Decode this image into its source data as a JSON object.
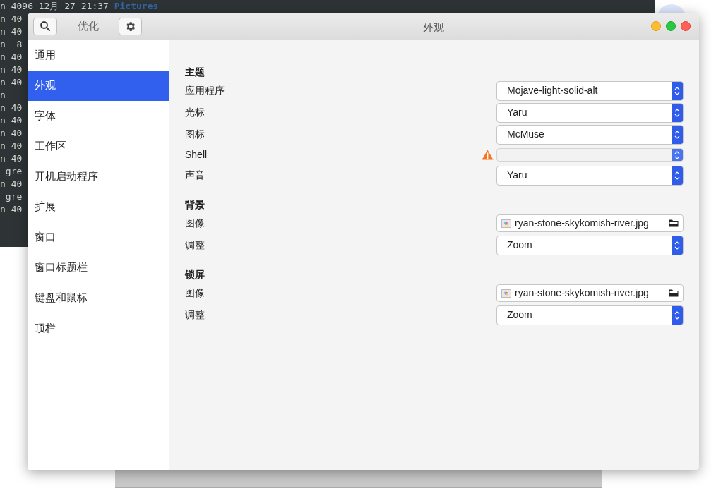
{
  "terminal": {
    "lines": [
      {
        "text": "n 4096 12月 27 21:37 ",
        "name": "Pictures"
      },
      {
        "text": "n 40"
      },
      {
        "text": "n 40"
      },
      {
        "text": "n  8"
      },
      {
        "text": "n 40"
      },
      {
        "text": "n 40"
      },
      {
        "text": "n 40"
      },
      {
        "text": "n"
      },
      {
        "text": "n 40"
      },
      {
        "text": "n 40"
      },
      {
        "text": "n 40"
      },
      {
        "text": "n 40"
      },
      {
        "text": "n 40"
      },
      {
        "text": " gre"
      },
      {
        "text": "n 40"
      },
      {
        "text": " gre"
      },
      {
        "text": "n 40"
      }
    ]
  },
  "window": {
    "app_title": "优化",
    "title": "外观"
  },
  "sidebar": {
    "items": [
      {
        "label": "通用",
        "selected": false
      },
      {
        "label": "外观",
        "selected": true
      },
      {
        "label": "字体",
        "selected": false
      },
      {
        "label": "工作区",
        "selected": false
      },
      {
        "label": "开机启动程序",
        "selected": false
      },
      {
        "label": "扩展",
        "selected": false
      },
      {
        "label": "窗口",
        "selected": false
      },
      {
        "label": "窗口标题栏",
        "selected": false
      },
      {
        "label": "键盘和鼠标",
        "selected": false
      },
      {
        "label": "顶栏",
        "selected": false
      }
    ]
  },
  "sections": [
    {
      "title": "主题",
      "rows": [
        {
          "label": "应用程序",
          "kind": "combo",
          "value": "Mojave-light-solid-alt",
          "disabled": false,
          "warning": false
        },
        {
          "label": "光标",
          "kind": "combo",
          "value": "Yaru",
          "disabled": false,
          "warning": false
        },
        {
          "label": "图标",
          "kind": "combo",
          "value": "McMuse",
          "disabled": false,
          "warning": false
        },
        {
          "label": "Shell",
          "kind": "combo",
          "disabled": true,
          "warning": true
        },
        {
          "label": "声音",
          "kind": "combo",
          "value": "Yaru",
          "disabled": false,
          "warning": false
        }
      ]
    },
    {
      "title": "背景",
      "rows": [
        {
          "label": "图像",
          "kind": "file",
          "value": "ryan-stone-skykomish-river.jpg"
        },
        {
          "label": "调整",
          "kind": "combo",
          "value": "Zoom",
          "disabled": false,
          "warning": false
        }
      ]
    },
    {
      "title": "锁屏",
      "rows": [
        {
          "label": "图像",
          "kind": "file",
          "value": "ryan-stone-skykomish-river.jpg"
        },
        {
          "label": "调整",
          "kind": "combo",
          "value": "Zoom",
          "disabled": false,
          "warning": false
        }
      ]
    }
  ]
}
